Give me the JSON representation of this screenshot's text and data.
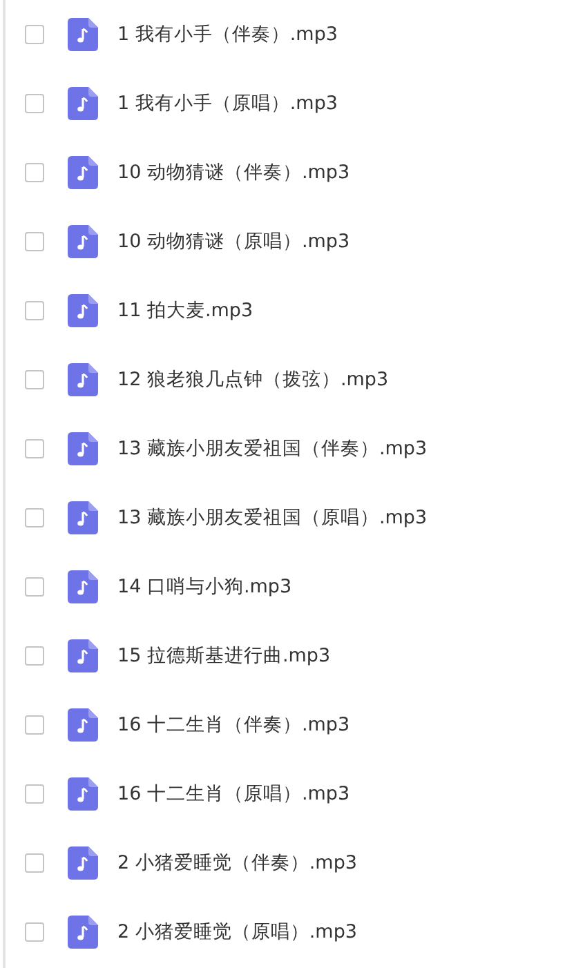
{
  "files": [
    {
      "name": "1 我有小手（伴奏）.mp3",
      "checked": false
    },
    {
      "name": "1 我有小手（原唱）.mp3",
      "checked": false
    },
    {
      "name": "10 动物猜谜（伴奏）.mp3",
      "checked": false
    },
    {
      "name": "10 动物猜谜（原唱）.mp3",
      "checked": false
    },
    {
      "name": "11 拍大麦.mp3",
      "checked": false
    },
    {
      "name": "12 狼老狼几点钟（拨弦）.mp3",
      "checked": false
    },
    {
      "name": "13 藏族小朋友爱祖国（伴奏）.mp3",
      "checked": false
    },
    {
      "name": "13 藏族小朋友爱祖国（原唱）.mp3",
      "checked": false
    },
    {
      "name": "14 口哨与小狗.mp3",
      "checked": false
    },
    {
      "name": "15 拉德斯基进行曲.mp3",
      "checked": false
    },
    {
      "name": "16 十二生肖（伴奏）.mp3",
      "checked": false
    },
    {
      "name": "16 十二生肖（原唱）.mp3",
      "checked": false
    },
    {
      "name": "2 小猪爱睡觉（伴奏）.mp3",
      "checked": false
    },
    {
      "name": "2 小猪爱睡觉（原唱）.mp3",
      "checked": false
    }
  ]
}
